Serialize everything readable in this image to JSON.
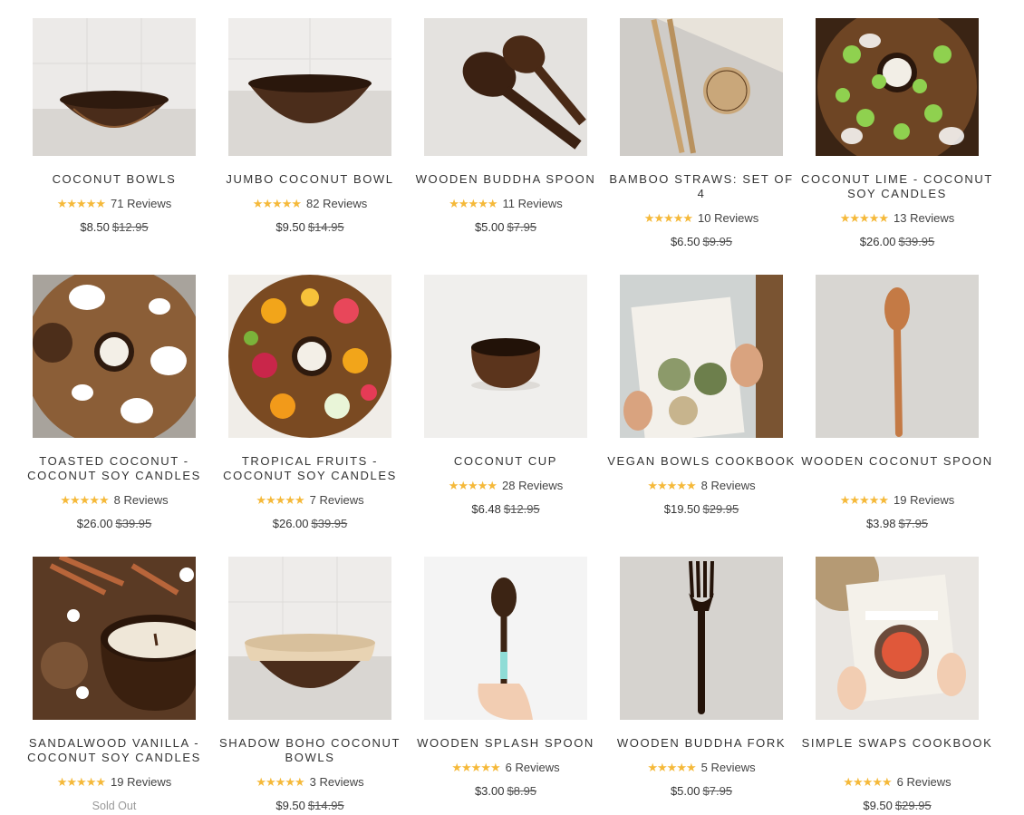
{
  "products": [
    {
      "title": "COCONUT BOWLS",
      "stars": "★★★★★",
      "reviews": "71 Reviews",
      "price": "$8.50",
      "was": "$12.95",
      "image": "coconut-bowl-photo"
    },
    {
      "title": "JUMBO COCONUT BOWL",
      "stars": "★★★★★",
      "reviews": "82 Reviews",
      "price": "$9.50",
      "was": "$14.95",
      "image": "jumbo-coconut-bowl-photo"
    },
    {
      "title": "WOODEN BUDDHA SPOON",
      "stars": "★★★★★",
      "reviews": "11 Reviews",
      "price": "$5.00",
      "was": "$7.95",
      "image": "wooden-spoons-photo"
    },
    {
      "title": "BAMBOO STRAWS: SET OF 4",
      "stars": "★★★★★",
      "reviews": "10 Reviews",
      "price": "$6.50",
      "was": "$9.95",
      "image": "bamboo-straws-photo"
    },
    {
      "title": "COCONUT LIME - COCONUT SOY CANDLES",
      "stars": "★★★★★",
      "reviews": "13 Reviews",
      "price": "$26.00",
      "was": "$39.95",
      "image": "lime-candle-photo"
    },
    {
      "title": "TOASTED COCONUT - COCONUT SOY CANDLES",
      "stars": "★★★★★",
      "reviews": "8 Reviews",
      "price": "$26.00",
      "was": "$39.95",
      "image": "toasted-coconut-candle-photo"
    },
    {
      "title": "TROPICAL FRUITS - COCONUT SOY CANDLES",
      "stars": "★★★★★",
      "reviews": "7 Reviews",
      "price": "$26.00",
      "was": "$39.95",
      "image": "tropical-fruits-candle-photo"
    },
    {
      "title": "COCONUT CUP",
      "stars": "★★★★★",
      "reviews": "28 Reviews",
      "price": "$6.48",
      "was": "$12.95",
      "image": "coconut-cup-photo"
    },
    {
      "title": "VEGAN BOWLS COOKBOOK",
      "stars": "★★★★★",
      "reviews": "8 Reviews",
      "price": "$19.50",
      "was": "$29.95",
      "image": "vegan-cookbook-photo"
    },
    {
      "title": "WOODEN COCONUT SPOON",
      "stars": "★★★★★",
      "reviews": "19 Reviews",
      "price": "$3.98",
      "was": "$7.95",
      "image": "wooden-coconut-spoon-photo"
    },
    {
      "title": "SANDALWOOD VANILLA - COCONUT SOY CANDLES",
      "stars": "★★★★★",
      "reviews": "19 Reviews",
      "price": "Sold Out",
      "was": "",
      "image": "sandalwood-candle-photo"
    },
    {
      "title": "SHADOW BOHO COCONUT BOWLS",
      "stars": "★★★★★",
      "reviews": "3 Reviews",
      "price": "$9.50",
      "was": "$14.95",
      "image": "boho-coconut-bowl-photo"
    },
    {
      "title": "WOODEN SPLASH SPOON",
      "stars": "★★★★★",
      "reviews": "6 Reviews",
      "price": "$3.00",
      "was": "$8.95",
      "image": "splash-spoon-photo"
    },
    {
      "title": "WOODEN BUDDHA FORK",
      "stars": "★★★★★",
      "reviews": "5 Reviews",
      "price": "$5.00",
      "was": "$7.95",
      "image": "wooden-fork-photo"
    },
    {
      "title": "SIMPLE SWAPS COOKBOOK",
      "stars": "★★★★★",
      "reviews": "6 Reviews",
      "price": "$9.50",
      "was": "$29.95",
      "image": "simple-swaps-cookbook-photo"
    }
  ],
  "colors": {
    "star": "#f5b93a",
    "text": "#333333",
    "soldout": "#999999"
  }
}
